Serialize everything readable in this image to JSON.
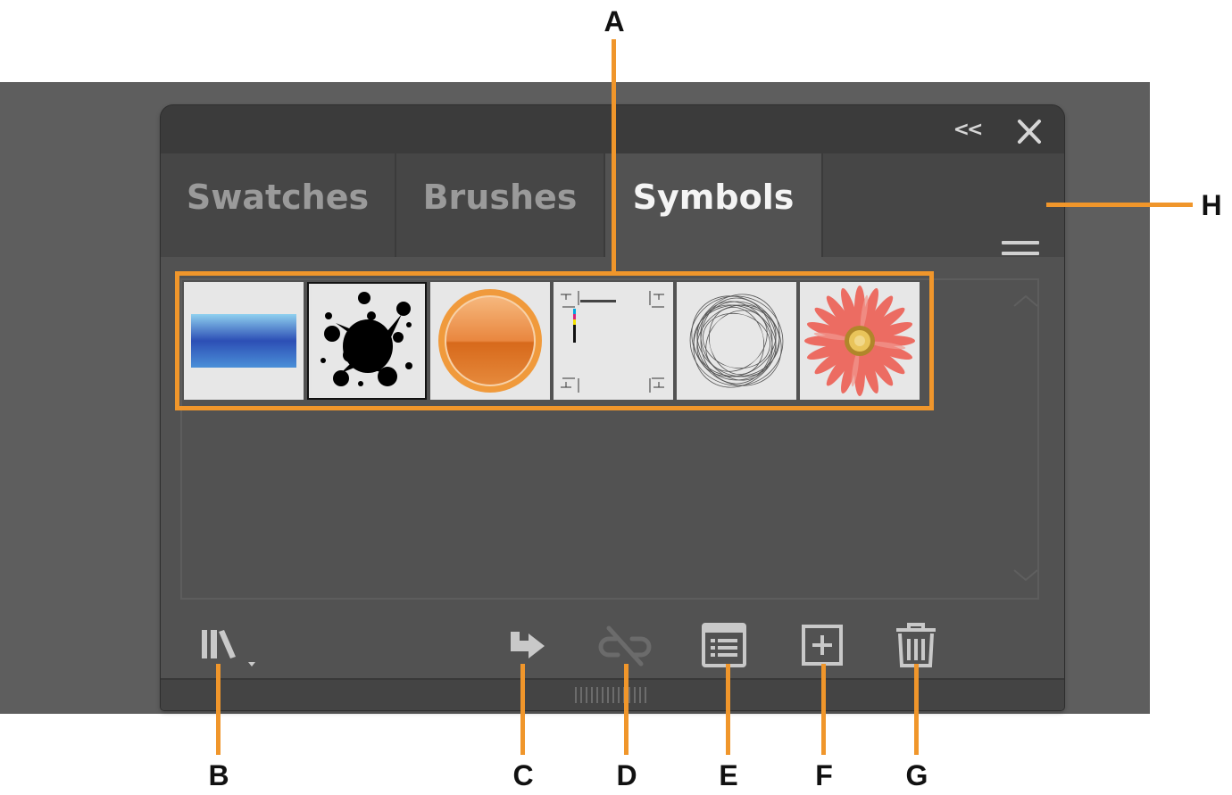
{
  "panel": {
    "collapse_label": "<<",
    "tabs": [
      {
        "label": "Swatches",
        "active": false
      },
      {
        "label": "Brushes",
        "active": false
      },
      {
        "label": "Symbols",
        "active": true
      }
    ]
  },
  "symbols": [
    {
      "name": "blue-gradient-banner"
    },
    {
      "name": "ink-splatter",
      "selected": true
    },
    {
      "name": "orange-circle-button"
    },
    {
      "name": "crop-marks"
    },
    {
      "name": "spiral-ring"
    },
    {
      "name": "daisy-flower"
    }
  ],
  "footer": {
    "icons": [
      "symbol-libraries-icon",
      "place-symbol-icon",
      "break-link-icon",
      "symbol-options-icon",
      "new-symbol-icon",
      "delete-symbol-icon"
    ]
  },
  "callouts": {
    "A": "A",
    "B": "B",
    "C": "C",
    "D": "D",
    "E": "E",
    "F": "F",
    "G": "G",
    "H": "H"
  },
  "colors": {
    "callout": "#f0962b",
    "panel_bg": "#525252",
    "tab_inactive": "#464646",
    "active_tab_text": "#f4f4f4",
    "inactive_tab_text": "#9a9a9a"
  }
}
